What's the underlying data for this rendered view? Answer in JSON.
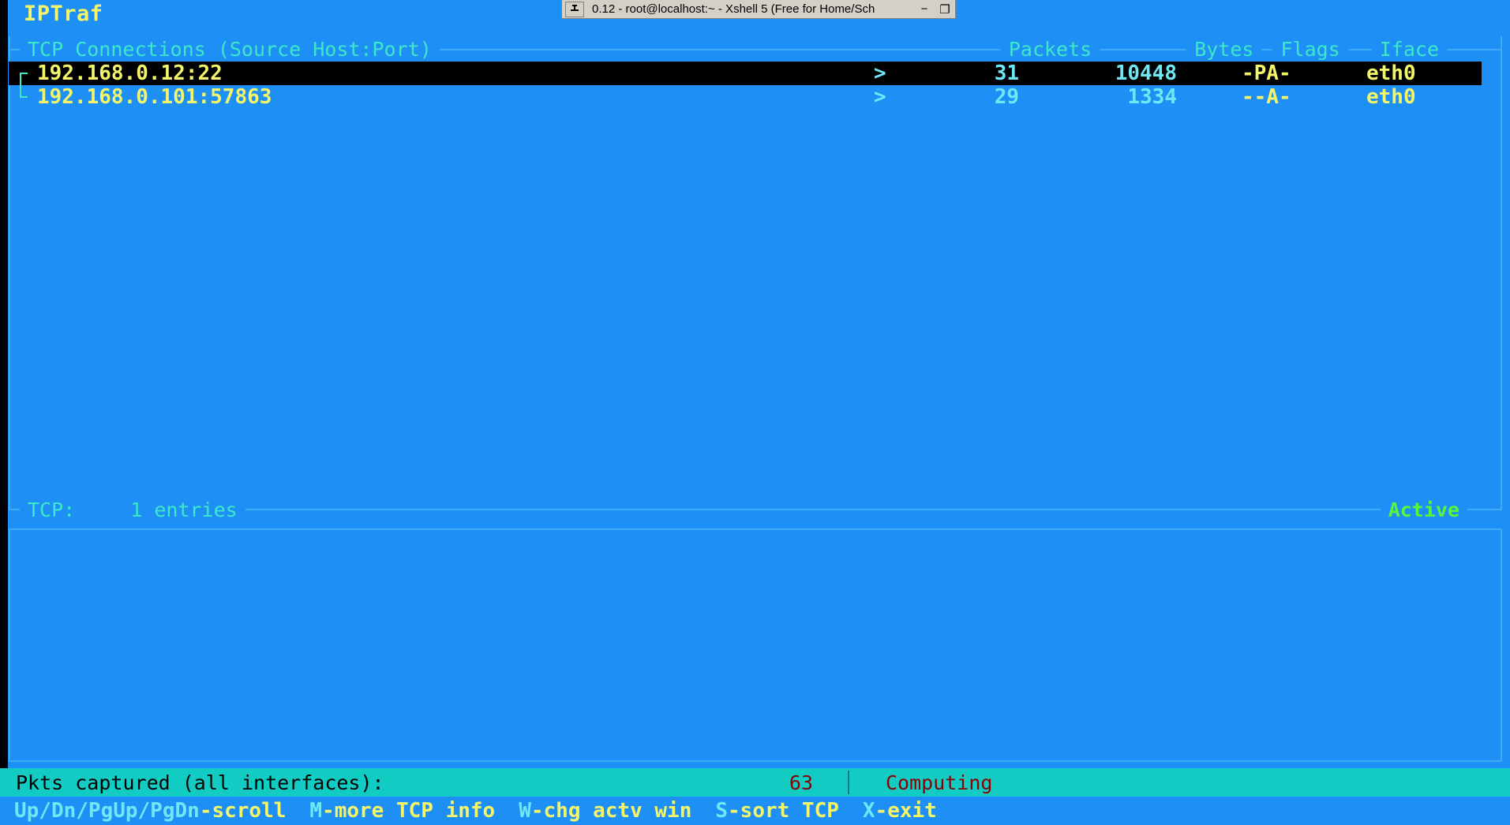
{
  "window": {
    "title": "0.12 - root@localhost:~ - Xshell 5 (Free for Home/Sch",
    "pin_icon": "pin-icon",
    "minimize_label": "−",
    "restore_label": "❐"
  },
  "app": {
    "title": "IPTraf"
  },
  "tcp_panel": {
    "headers": {
      "source": "TCP Connections (Source Host:Port)",
      "packets": "Packets",
      "bytes": "Bytes",
      "flags": "Flags",
      "iface": "Iface"
    },
    "connections": [
      {
        "host": "192.168.0.12:22",
        "arrow": ">",
        "packets": "31",
        "bytes": "10448",
        "flags": "-PA-",
        "iface": "eth0",
        "selected": true
      },
      {
        "host": "192.168.0.101:57863",
        "arrow": ">",
        "packets": "29",
        "bytes": "1334",
        "flags": "--A-",
        "iface": "eth0",
        "selected": false
      }
    ],
    "footer": {
      "label": "TCP:",
      "count": "1 entries",
      "state": "Active"
    }
  },
  "status": {
    "caption": "Pkts captured (all interfaces):",
    "count": "63",
    "state": "Computing"
  },
  "keys": [
    {
      "key": "Up/Dn/PgUp/PgDn",
      "desc": "-scroll"
    },
    {
      "key": "M",
      "desc": "-more TCP info"
    },
    {
      "key": "W",
      "desc": "-chg actv win"
    },
    {
      "key": "S",
      "desc": "-sort TCP"
    },
    {
      "key": "X",
      "desc": "-exit"
    }
  ],
  "colors": {
    "screen_bg": "#1e90f5",
    "border": "#3ea9f5",
    "header_text": "#3ce8c8",
    "host_text": "#f5f569",
    "number_text": "#6ee8f5",
    "active_text": "#5bf53c",
    "status_bg": "#12ccc4",
    "status_alert": "#8c0000",
    "selected_bg": "#000000"
  }
}
